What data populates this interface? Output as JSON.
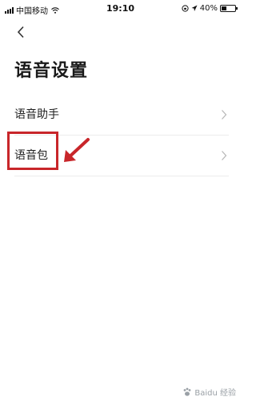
{
  "status_bar": {
    "carrier": "中国移动",
    "time": "19:10",
    "battery_percent": "40%",
    "battery_level": 0.4
  },
  "header": {
    "back_icon": "chevron-left-icon",
    "title": "语音设置"
  },
  "settings": {
    "items": [
      {
        "label": "语音助手",
        "icon": "chevron-right-icon"
      },
      {
        "label": "语音包",
        "icon": "chevron-right-icon"
      }
    ]
  },
  "annotation": {
    "highlight_color": "#c8262a",
    "arrow_color": "#c8262a"
  },
  "watermark": {
    "text": "Baidu 经验"
  }
}
